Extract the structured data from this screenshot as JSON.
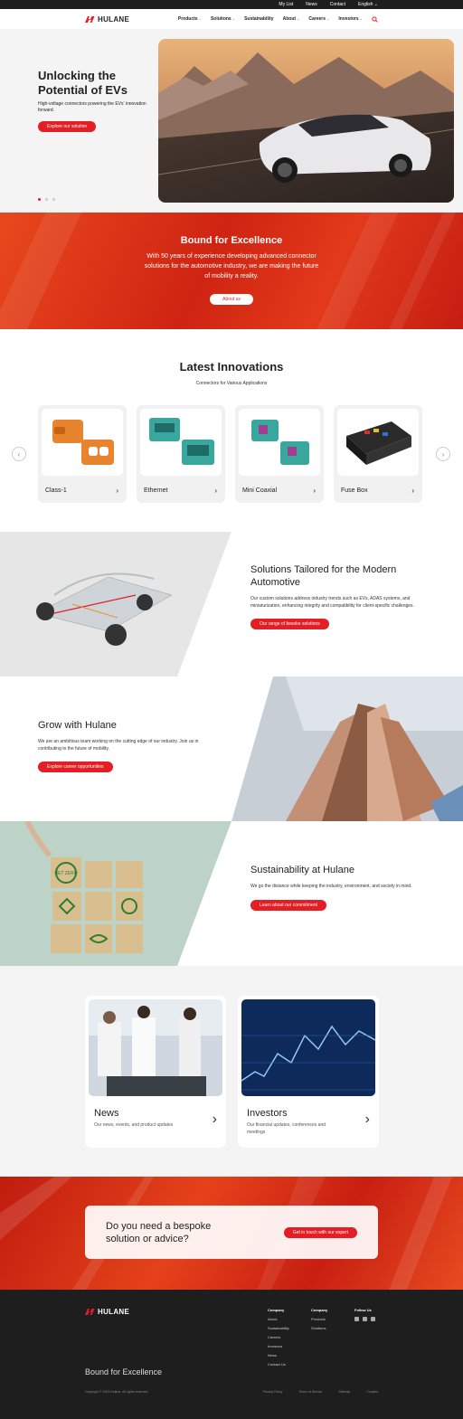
{
  "topbar": {
    "links": [
      "My List",
      "News",
      "Contact"
    ],
    "language": "English"
  },
  "nav": {
    "brand": "HULANE",
    "items": [
      {
        "label": "Products",
        "has_dropdown": true
      },
      {
        "label": "Solutions",
        "has_dropdown": true
      },
      {
        "label": "Sustainability",
        "has_dropdown": false
      },
      {
        "label": "About",
        "has_dropdown": true
      },
      {
        "label": "Careers",
        "has_dropdown": true
      },
      {
        "label": "Investors",
        "has_dropdown": true
      }
    ],
    "search_icon": "search-icon"
  },
  "hero": {
    "title": "Unlocking the Potential of EVs",
    "subtitle": "High-voltage connectors powering the EVs' innovation forward.",
    "cta": "Explore our solution",
    "slides": 3,
    "active_slide": 1
  },
  "excellence": {
    "title": "Bound for Excellence",
    "text": "With 50 years of experience developing advanced connector solutions for the automotive industry, we are making the future of mobility a reality.",
    "cta": "About us"
  },
  "innovations": {
    "title": "Latest Innovations",
    "subtitle": "Connectors for Various Applications",
    "cards": [
      {
        "label": "Class-1"
      },
      {
        "label": "Ethernet"
      },
      {
        "label": "Mini Coaxial"
      },
      {
        "label": "Fuse Box"
      }
    ]
  },
  "solutions": {
    "title": "Solutions Tailored for the Modern Automotive",
    "text": "Our custom solutions address industry trends such as EVs, ADAS systems, and miniaturization, enhancing integrity and compatibility for client-specific challenges.",
    "cta": "Our range of besoke solutions"
  },
  "careers": {
    "title": "Grow with Hulane",
    "text": "We are an ambitious team working on the cutting edge of our industry. Join us in contributing to the future of mobility.",
    "cta": "Explore career opportunities"
  },
  "sustainability": {
    "title": "Sustainability at Hulane",
    "text": "We go the distance while keeping the industry, environment, and society in mind.",
    "cta": "Learn about our commitment",
    "block_labels": [
      "NET ZERO"
    ]
  },
  "tiles": [
    {
      "title": "News",
      "text": "Our news, events, and product updates"
    },
    {
      "title": "Investors",
      "text": "Our financial updates, conferences and meetings"
    }
  ],
  "cta": {
    "title": "Do you need a bespoke solution or advice?",
    "button": "Get in touch with our expert"
  },
  "footer": {
    "brand": "HULANE",
    "col1": {
      "title": "Company",
      "links": [
        "About",
        "Sustainability",
        "Careers",
        "Investors",
        "News",
        "Contact Us"
      ]
    },
    "col2": {
      "title": "Company",
      "links": [
        "Products",
        "Solutions"
      ]
    },
    "col3": {
      "title": "Follow Us"
    },
    "tagline": "Bound for Excellence",
    "copyright": "Copyright © 2024 Hulane. All rights reserved.",
    "legal": [
      "Privacy Policy",
      "Terms of Service",
      "Sitemap",
      "Cookies"
    ]
  },
  "colors": {
    "accent": "#e31e24",
    "dark": "#1e1e1e",
    "light_bg": "#f4f4f4"
  }
}
